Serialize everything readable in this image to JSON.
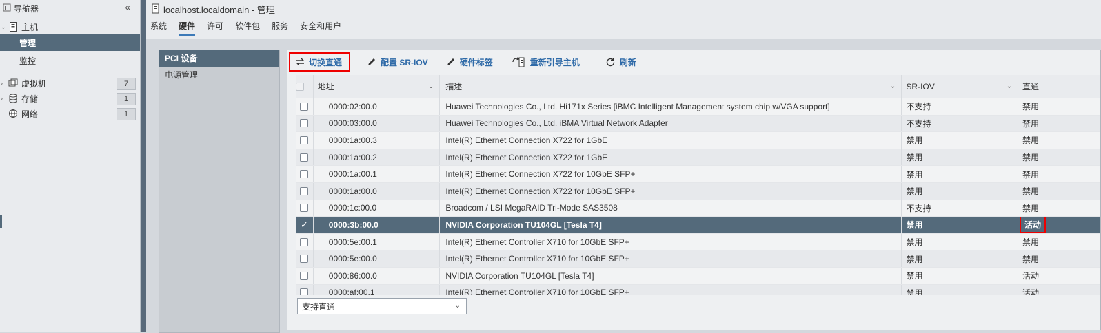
{
  "navigator": {
    "title": "导航器",
    "host": {
      "label": "主机",
      "children": [
        {
          "label": "管理",
          "active": true
        },
        {
          "label": "监控",
          "active": false
        }
      ]
    },
    "items": [
      {
        "label": "虚拟机",
        "count": "7",
        "icon": "vm-icon"
      },
      {
        "label": "存储",
        "count": "1",
        "icon": "storage-icon"
      },
      {
        "label": "网络",
        "count": "1",
        "icon": "network-icon"
      }
    ]
  },
  "header": {
    "title": "localhost.localdomain - 管理",
    "tabs": [
      {
        "label": "系统",
        "active": false
      },
      {
        "label": "硬件",
        "active": true
      },
      {
        "label": "许可",
        "active": false
      },
      {
        "label": "软件包",
        "active": false
      },
      {
        "label": "服务",
        "active": false
      },
      {
        "label": "安全和用户",
        "active": false
      }
    ]
  },
  "side_menu": [
    {
      "label": "PCI 设备",
      "active": true
    },
    {
      "label": "电源管理",
      "active": false
    }
  ],
  "toolbar": {
    "toggle_passthrough": "切换直通",
    "configure_sriov": "配置 SR-IOV",
    "hardware_label": "硬件标签",
    "reboot_host": "重新引导主机",
    "refresh": "刷新"
  },
  "table": {
    "columns": {
      "address": "地址",
      "description": "描述",
      "sriov": "SR-IOV",
      "passthrough": "直通"
    },
    "rows": [
      {
        "address": "0000:02:00.0",
        "description": "Huawei Technologies Co., Ltd. Hi171x Series [iBMC Intelligent Management system chip w/VGA support]",
        "sriov": "不支持",
        "passthrough": "禁用",
        "selected": false
      },
      {
        "address": "0000:03:00.0",
        "description": "Huawei Technologies Co., Ltd. iBMA Virtual Network Adapter",
        "sriov": "不支持",
        "passthrough": "禁用",
        "selected": false
      },
      {
        "address": "0000:1a:00.3",
        "description": "Intel(R) Ethernet Connection X722 for 1GbE",
        "sriov": "禁用",
        "passthrough": "禁用",
        "selected": false
      },
      {
        "address": "0000:1a:00.2",
        "description": "Intel(R) Ethernet Connection X722 for 1GbE",
        "sriov": "禁用",
        "passthrough": "禁用",
        "selected": false
      },
      {
        "address": "0000:1a:00.1",
        "description": "Intel(R) Ethernet Connection X722 for 10GbE SFP+",
        "sriov": "禁用",
        "passthrough": "禁用",
        "selected": false
      },
      {
        "address": "0000:1a:00.0",
        "description": "Intel(R) Ethernet Connection X722 for 10GbE SFP+",
        "sriov": "禁用",
        "passthrough": "禁用",
        "selected": false
      },
      {
        "address": "0000:1c:00.0",
        "description": "Broadcom / LSI MegaRAID Tri-Mode SAS3508",
        "sriov": "不支持",
        "passthrough": "禁用",
        "selected": false
      },
      {
        "address": "0000:3b:00.0",
        "description": "NVIDIA Corporation TU104GL [Tesla T4]",
        "sriov": "禁用",
        "passthrough": "活动",
        "selected": true
      },
      {
        "address": "0000:5e:00.1",
        "description": "Intel(R) Ethernet Controller X710 for 10GbE SFP+",
        "sriov": "禁用",
        "passthrough": "禁用",
        "selected": false
      },
      {
        "address": "0000:5e:00.0",
        "description": "Intel(R) Ethernet Controller X710 for 10GbE SFP+",
        "sriov": "禁用",
        "passthrough": "禁用",
        "selected": false
      },
      {
        "address": "0000:86:00.0",
        "description": "NVIDIA Corporation TU104GL [Tesla T4]",
        "sriov": "禁用",
        "passthrough": "活动",
        "selected": false
      },
      {
        "address": "0000:af:00.1",
        "description": "Intel(R) Ethernet Controller X710 for 10GbE SFP+",
        "sriov": "禁用",
        "passthrough": "活动",
        "selected": false
      }
    ]
  },
  "filter": {
    "selected": "支持直通"
  },
  "colors": {
    "accent": "#546a7b",
    "link": "#2e6aa8",
    "highlight": "#e00000"
  }
}
